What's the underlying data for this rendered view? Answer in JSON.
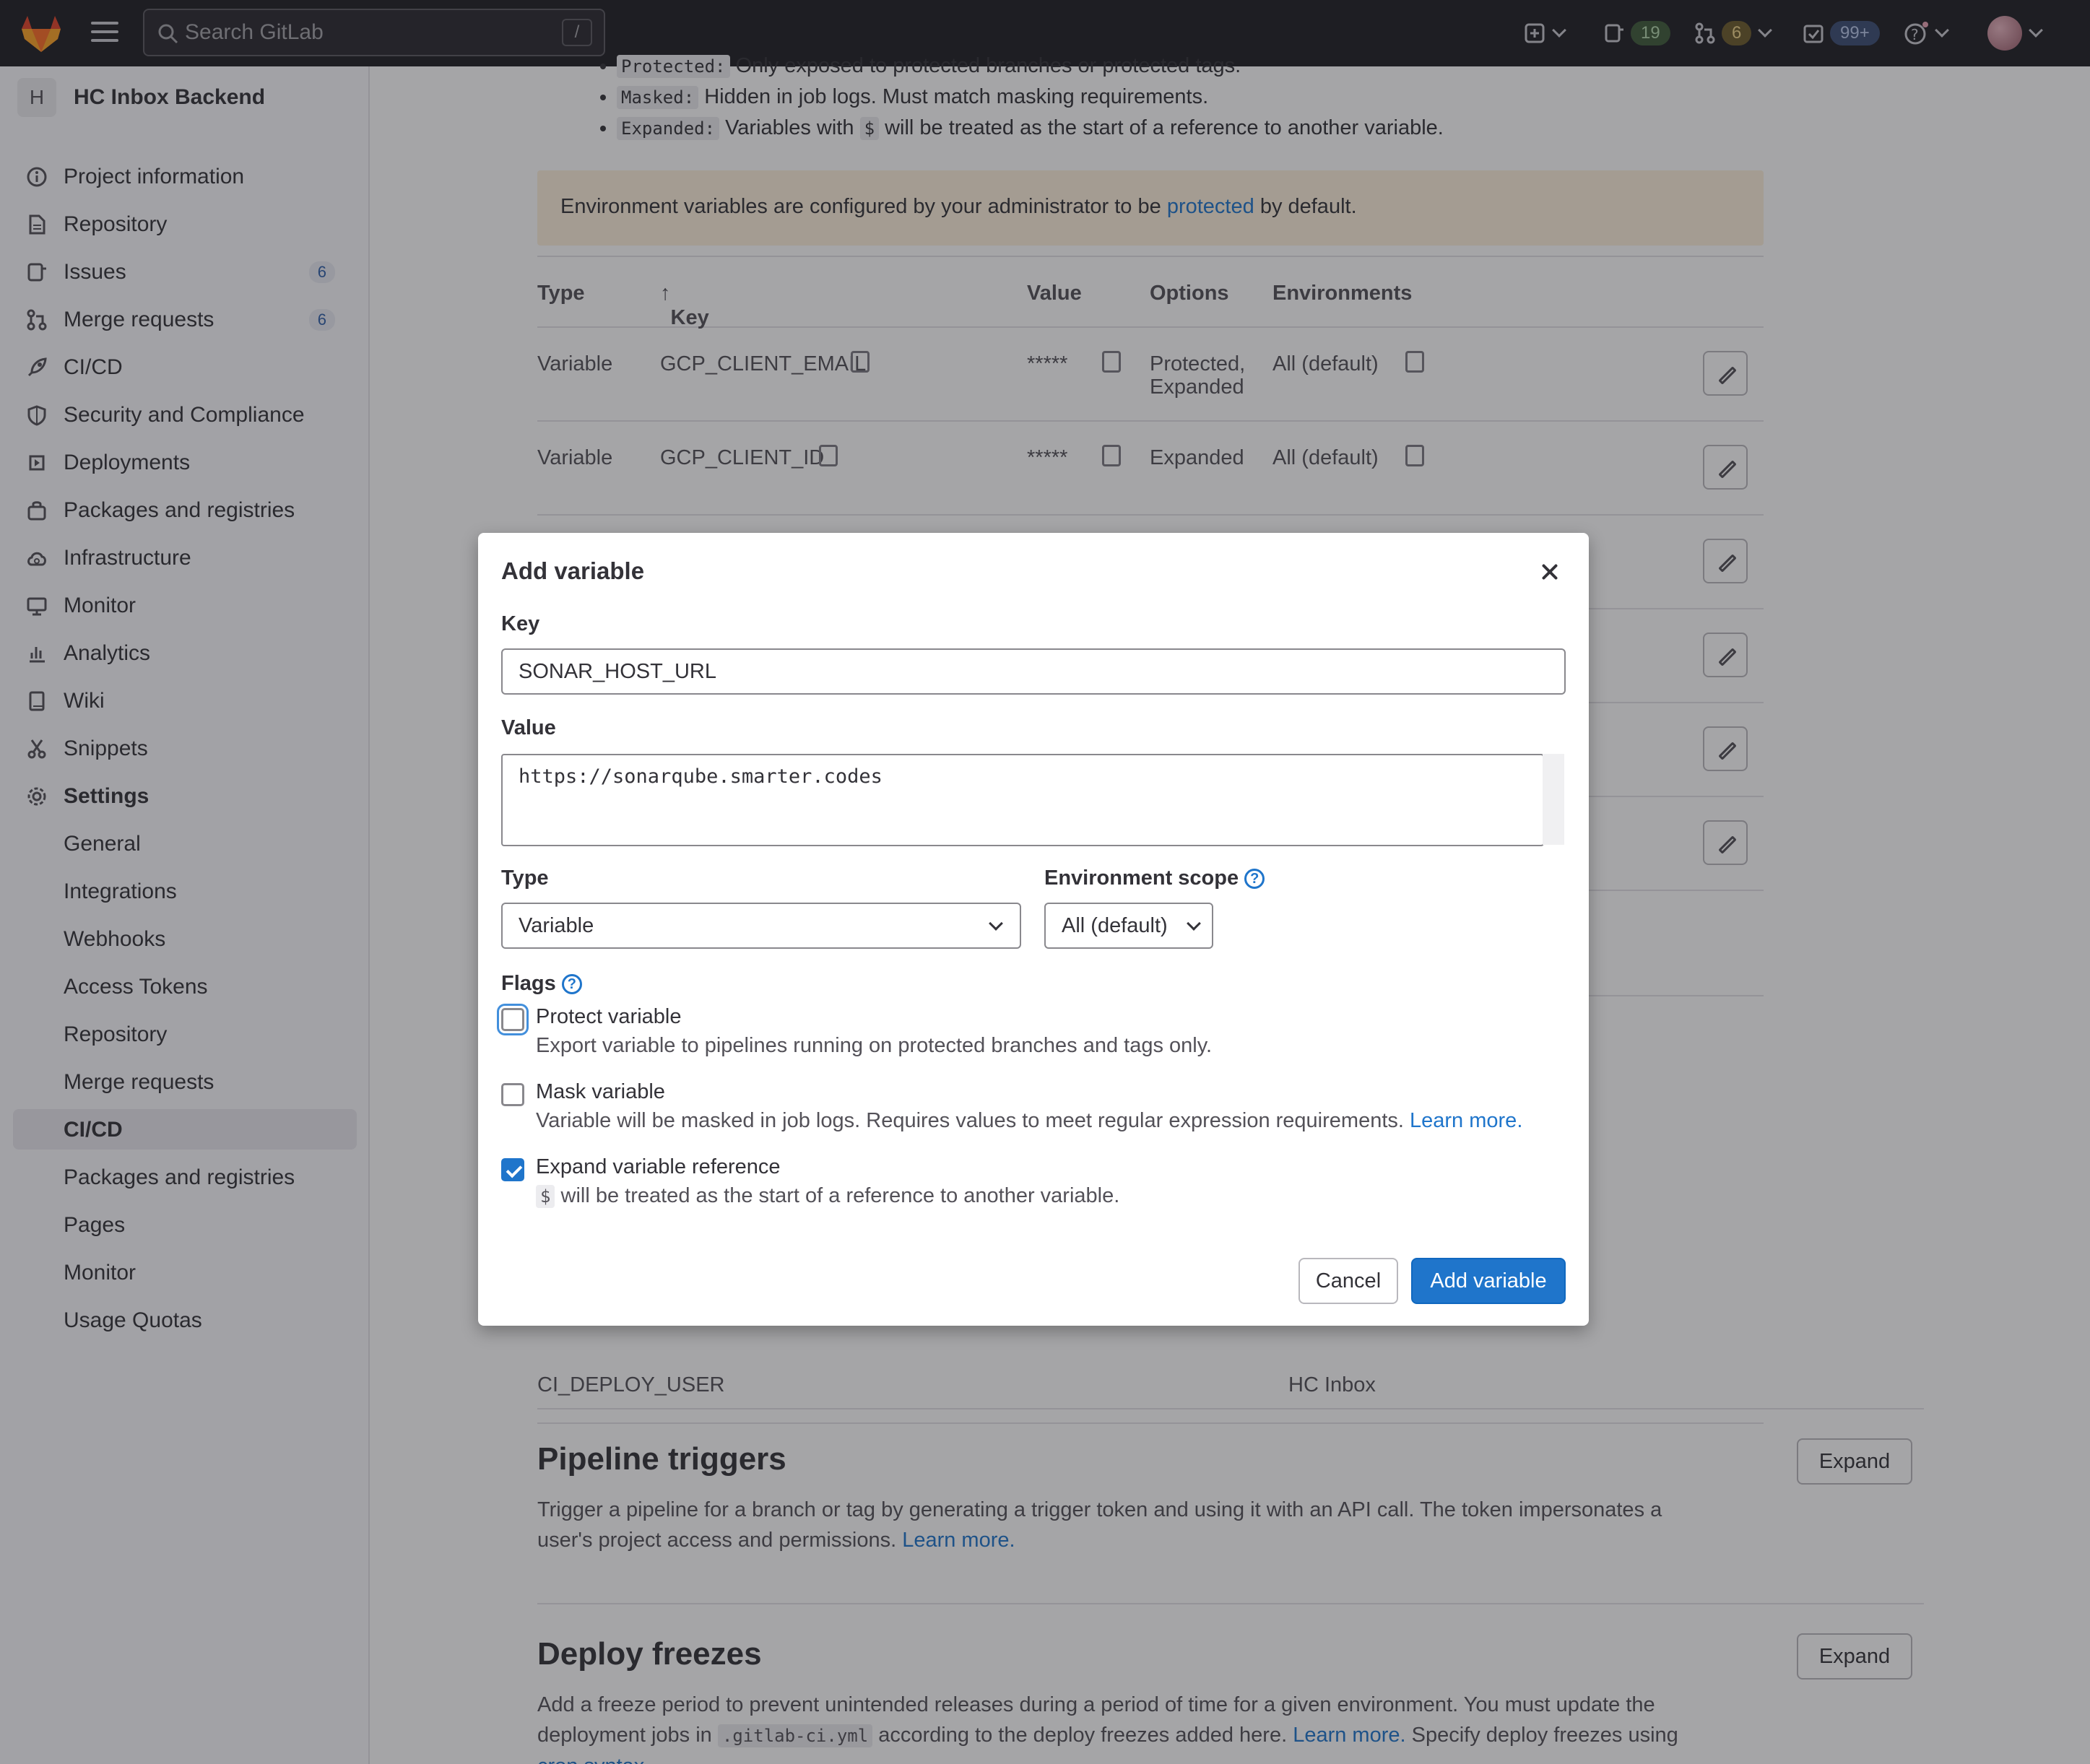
{
  "topbar": {
    "search_placeholder": "Search GitLab",
    "search_shortcut": "/",
    "issues_count": "19",
    "merge_requests_count": "6",
    "todos_count": "99+"
  },
  "sidebar": {
    "project_initial": "H",
    "project_name": "HC Inbox Backend",
    "items": [
      {
        "label": "Project information",
        "icon": "info-icon"
      },
      {
        "label": "Repository",
        "icon": "document-icon"
      },
      {
        "label": "Issues",
        "icon": "issues-icon",
        "badge": "6"
      },
      {
        "label": "Merge requests",
        "icon": "merge-request-icon",
        "badge": "6"
      },
      {
        "label": "CI/CD",
        "icon": "rocket-icon"
      },
      {
        "label": "Security and Compliance",
        "icon": "shield-icon"
      },
      {
        "label": "Deployments",
        "icon": "deployments-icon"
      },
      {
        "label": "Packages and registries",
        "icon": "package-icon"
      },
      {
        "label": "Infrastructure",
        "icon": "cloud-icon"
      },
      {
        "label": "Monitor",
        "icon": "monitor-icon"
      },
      {
        "label": "Analytics",
        "icon": "chart-icon"
      },
      {
        "label": "Wiki",
        "icon": "book-icon"
      },
      {
        "label": "Snippets",
        "icon": "scissors-icon"
      },
      {
        "label": "Settings",
        "icon": "gear-icon"
      }
    ],
    "settings_sub": [
      "General",
      "Integrations",
      "Webhooks",
      "Access Tokens",
      "Repository",
      "Merge requests",
      "CI/CD",
      "Packages and registries",
      "Pages",
      "Monitor",
      "Usage Quotas"
    ]
  },
  "main": {
    "bullet_protected_code": "Protected:",
    "bullet_protected_text": "Only exposed to protected branches or protected tags.",
    "bullet_masked_code": "Masked:",
    "bullet_masked_text": "Hidden in job logs. Must match masking requirements.",
    "bullet_expanded_code": "Expanded:",
    "bullet_expanded_text_a": "Variables with",
    "bullet_expanded_dollar": "$",
    "bullet_expanded_text_b": "will be treated as the start of a reference to another variable.",
    "notice_a": "Environment variables are configured by your administrator to be",
    "notice_link": "protected",
    "notice_b": "by default.",
    "table_headers": {
      "type": "Type",
      "key": "Key",
      "value": "Value",
      "options": "Options",
      "environments": "Environments"
    },
    "rows": [
      {
        "type": "Variable",
        "key": "GCP_CLIENT_EMAIL",
        "value": "*****",
        "options_1": "Protected,",
        "options_2": "Expanded",
        "env": "All (default)"
      },
      {
        "type": "Variable",
        "key": "GCP_CLIENT_ID",
        "value": "*****",
        "options_1": "Expanded",
        "options_2": "",
        "env": "All (default)"
      }
    ],
    "partial_row_key": "CI_DEPLOY_USER",
    "partial_row_env": "HC Inbox",
    "pipeline_triggers": {
      "title": "Pipeline triggers",
      "text": "Trigger a pipeline for a branch or tag by generating a trigger token and using it with an API call. The token impersonates a user's project access and permissions.",
      "link": "Learn more.",
      "expand": "Expand"
    },
    "deploy_freezes": {
      "title": "Deploy freezes",
      "text_a": "Add a freeze period to prevent unintended releases during a period of time for a given environment. You must update the deployment jobs in",
      "code": ".gitlab-ci.yml",
      "text_b": "according to the deploy freezes added here.",
      "link": "Learn more.",
      "text_c": "Specify deploy freezes using",
      "link2": "cron syntax.",
      "expand": "Expand"
    }
  },
  "modal": {
    "title": "Add variable",
    "key_label": "Key",
    "key_value": "SONAR_HOST_URL",
    "value_label": "Value",
    "value_value": "https://sonarqube.smarter.codes",
    "type_label": "Type",
    "type_value": "Variable",
    "env_scope_label": "Environment scope",
    "env_scope_value": "All (default)",
    "flags_label": "Flags",
    "protect_label": "Protect variable",
    "protect_help": "Export variable to pipelines running on protected branches and tags only.",
    "protect_checked": false,
    "mask_label": "Mask variable",
    "mask_help": "Variable will be masked in job logs. Requires values to meet regular expression requirements.",
    "mask_link": "Learn more.",
    "mask_checked": false,
    "expand_label": "Expand variable reference",
    "expand_dollar": "$",
    "expand_help": "will be treated as the start of a reference to another variable.",
    "expand_checked": true,
    "cancel": "Cancel",
    "submit": "Add variable"
  },
  "colors": {
    "accent": "#1f75cb",
    "topbar": "#1f1e24",
    "notice": "#fdf1dd"
  }
}
